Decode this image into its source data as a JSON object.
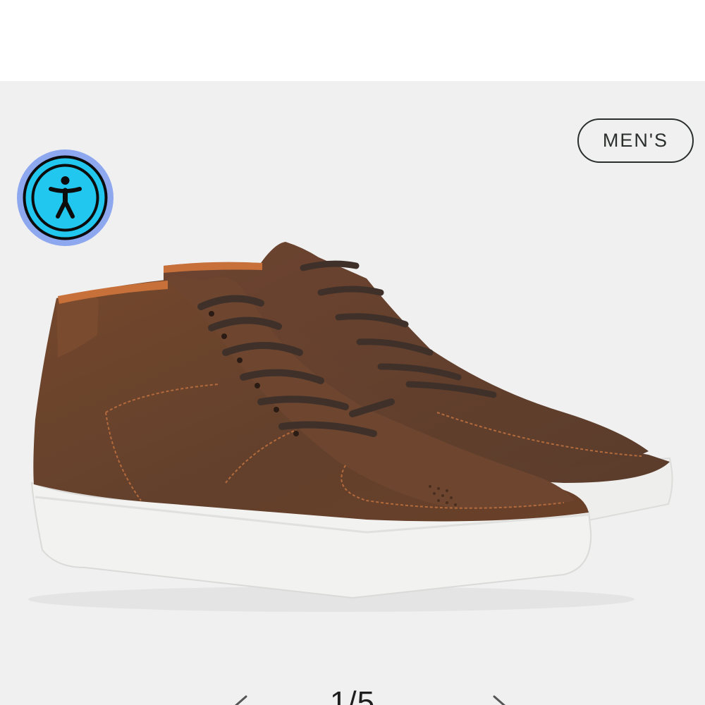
{
  "header": {},
  "product": {
    "category_badge": "MEN'S",
    "image": {
      "icon": "high-top-leather-sneakers",
      "upper_color": "#6b4129",
      "sole_color": "#f2f2f0",
      "lace_color": "#3f3129",
      "lining_color": "#c8703a"
    }
  },
  "accessibility": {
    "icon": "accessibility-person-icon",
    "ring_color": "#8ea8f0",
    "fill_color": "#22c7f0"
  },
  "gallery_pager": {
    "current": 1,
    "total": 5,
    "counter_text": "1/5",
    "prev_icon": "chevron-left-icon",
    "next_icon": "chevron-right-icon"
  },
  "colors": {
    "gallery_background": "#f0f0f0",
    "text": "#2a2f2c"
  }
}
